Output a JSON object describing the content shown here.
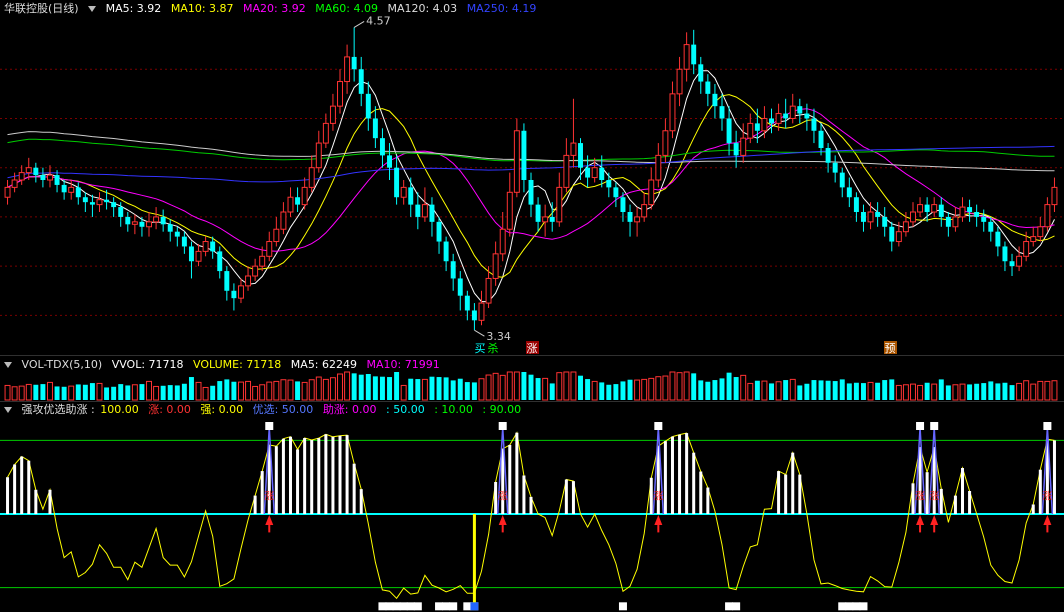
{
  "price_header": {
    "title": "华联控股(日线)",
    "ma5_label": "MA5: 3.92",
    "ma10_label": "MA10: 3.87",
    "ma20_label": "MA20: 3.92",
    "ma60_label": "MA60: 4.09",
    "ma120_label": "MA120: 4.03",
    "ma250_label": "MA250: 4.19"
  },
  "vol_header": {
    "title": "VOL-TDX(5,10)",
    "vvol_label": "VVOL: 71718",
    "volume_label": "VOLUME: 71718",
    "ma5_label": "MA5: 62249",
    "ma10_label": "MA10: 71991"
  },
  "ind_header": {
    "title": "强攻优选助涨 :",
    "v1": "100.00",
    "zhang_label": "涨: 0.00",
    "qiang_label": "强: 0.00",
    "youxuan_label": "优选: 50.00",
    "zhuzhang_label": "助涨: 0.00",
    "v2": ": 50.00",
    "v3": ": 10.00",
    "v4": ": 90.00"
  },
  "annotations": {
    "high": "4.57",
    "low": "3.34",
    "buy": "买",
    "kill": "杀",
    "rise": "涨",
    "pre": "预"
  },
  "colors": {
    "ma5": "#ffffff",
    "ma10": "#ffff00",
    "ma20": "#ff00ff",
    "ma60": "#00cc00",
    "ma120": "#cccccc",
    "ma250": "#3333ff",
    "up": "#ff3333",
    "down": "#00ffff"
  },
  "chart_data": [
    {
      "type": "candlestick",
      "title": "华联控股(日线)",
      "ylim": [
        3.3,
        4.6
      ],
      "high_marker": 4.57,
      "low_marker": 3.34,
      "ma_latest": {
        "MA5": 3.92,
        "MA10": 3.87,
        "MA20": 3.92,
        "MA60": 4.09,
        "MA120": 4.03,
        "MA250": 4.19
      },
      "candles": [
        [
          3.88,
          3.92,
          3.85,
          3.95
        ],
        [
          3.92,
          3.95,
          3.9,
          3.98
        ],
        [
          3.95,
          3.98,
          3.93,
          4.01
        ],
        [
          3.98,
          4.0,
          3.95,
          4.04
        ],
        [
          4.0,
          3.97,
          3.94,
          4.02
        ],
        [
          3.97,
          3.95,
          3.92,
          4.0
        ],
        [
          3.95,
          3.97,
          3.92,
          4.01
        ],
        [
          3.97,
          3.93,
          3.9,
          3.99
        ],
        [
          3.93,
          3.9,
          3.87,
          3.95
        ],
        [
          3.9,
          3.92,
          3.87,
          3.95
        ],
        [
          3.92,
          3.88,
          3.85,
          3.94
        ],
        [
          3.88,
          3.86,
          3.82,
          3.9
        ],
        [
          3.86,
          3.85,
          3.8,
          3.89
        ],
        [
          3.85,
          3.87,
          3.82,
          3.9
        ],
        [
          3.87,
          3.86,
          3.83,
          3.91
        ],
        [
          3.86,
          3.84,
          3.8,
          3.88
        ],
        [
          3.84,
          3.8,
          3.76,
          3.86
        ],
        [
          3.8,
          3.77,
          3.74,
          3.82
        ],
        [
          3.77,
          3.78,
          3.73,
          3.81
        ],
        [
          3.78,
          3.76,
          3.72,
          3.8
        ],
        [
          3.76,
          3.78,
          3.72,
          3.82
        ],
        [
          3.78,
          3.8,
          3.75,
          3.84
        ],
        [
          3.8,
          3.77,
          3.74,
          3.83
        ],
        [
          3.77,
          3.74,
          3.7,
          3.79
        ],
        [
          3.74,
          3.72,
          3.68,
          3.76
        ],
        [
          3.72,
          3.68,
          3.65,
          3.74
        ],
        [
          3.68,
          3.62,
          3.55,
          3.7
        ],
        [
          3.62,
          3.66,
          3.6,
          3.69
        ],
        [
          3.66,
          3.7,
          3.64,
          3.72
        ],
        [
          3.7,
          3.66,
          3.63,
          3.72
        ],
        [
          3.66,
          3.58,
          3.55,
          3.68
        ],
        [
          3.58,
          3.5,
          3.46,
          3.6
        ],
        [
          3.5,
          3.47,
          3.42,
          3.53
        ],
        [
          3.47,
          3.52,
          3.45,
          3.55
        ],
        [
          3.52,
          3.56,
          3.5,
          3.6
        ],
        [
          3.56,
          3.6,
          3.54,
          3.63
        ],
        [
          3.6,
          3.64,
          3.58,
          3.68
        ],
        [
          3.64,
          3.7,
          3.62,
          3.74
        ],
        [
          3.7,
          3.75,
          3.68,
          3.8
        ],
        [
          3.75,
          3.82,
          3.73,
          3.86
        ],
        [
          3.82,
          3.88,
          3.8,
          3.92
        ],
        [
          3.88,
          3.85,
          3.82,
          3.92
        ],
        [
          3.85,
          3.92,
          3.83,
          3.96
        ],
        [
          3.92,
          4.0,
          3.9,
          4.05
        ],
        [
          4.0,
          4.1,
          3.98,
          4.15
        ],
        [
          4.1,
          4.18,
          4.08,
          4.22
        ],
        [
          4.18,
          4.25,
          4.15,
          4.3
        ],
        [
          4.25,
          4.35,
          4.22,
          4.4
        ],
        [
          4.35,
          4.45,
          4.3,
          4.5
        ],
        [
          4.45,
          4.4,
          4.35,
          4.57
        ],
        [
          4.4,
          4.3,
          4.25,
          4.45
        ],
        [
          4.3,
          4.2,
          4.15,
          4.35
        ],
        [
          4.2,
          4.12,
          4.08,
          4.25
        ],
        [
          4.12,
          4.05,
          4.0,
          4.16
        ],
        [
          4.05,
          4.0,
          3.95,
          4.1
        ],
        [
          4.0,
          3.88,
          3.85,
          4.05
        ],
        [
          3.88,
          3.92,
          3.85,
          3.95
        ],
        [
          3.92,
          3.85,
          3.8,
          3.96
        ],
        [
          3.85,
          3.8,
          3.75,
          3.9
        ],
        [
          3.8,
          3.85,
          3.78,
          3.92
        ],
        [
          3.85,
          3.78,
          3.72,
          3.88
        ],
        [
          3.78,
          3.7,
          3.65,
          3.8
        ],
        [
          3.7,
          3.62,
          3.58,
          3.72
        ],
        [
          3.62,
          3.55,
          3.5,
          3.65
        ],
        [
          3.55,
          3.48,
          3.42,
          3.58
        ],
        [
          3.48,
          3.42,
          3.38,
          3.5
        ],
        [
          3.42,
          3.38,
          3.34,
          3.45
        ],
        [
          3.38,
          3.45,
          3.36,
          3.5
        ],
        [
          3.45,
          3.55,
          3.43,
          3.6
        ],
        [
          3.55,
          3.65,
          3.52,
          3.7
        ],
        [
          3.65,
          3.75,
          3.62,
          3.82
        ],
        [
          3.75,
          3.9,
          3.72,
          3.98
        ],
        [
          3.9,
          4.15,
          3.88,
          4.2
        ],
        [
          4.15,
          3.95,
          3.9,
          4.18
        ],
        [
          3.95,
          3.85,
          3.8,
          3.98
        ],
        [
          3.85,
          3.78,
          3.74,
          3.88
        ],
        [
          3.78,
          3.8,
          3.72,
          3.85
        ],
        [
          3.8,
          3.78,
          3.74,
          3.86
        ],
        [
          3.78,
          3.92,
          3.76,
          3.98
        ],
        [
          3.92,
          4.05,
          3.9,
          4.12
        ],
        [
          4.05,
          4.1,
          4.0,
          4.28
        ],
        [
          4.1,
          4.0,
          3.95,
          4.12
        ],
        [
          4.0,
          3.96,
          3.92,
          4.05
        ],
        [
          3.96,
          4.0,
          3.94,
          4.04
        ],
        [
          4.0,
          3.95,
          3.92,
          4.05
        ],
        [
          3.95,
          3.92,
          3.88,
          3.98
        ],
        [
          3.92,
          3.88,
          3.84,
          3.94
        ],
        [
          3.88,
          3.82,
          3.78,
          3.9
        ],
        [
          3.82,
          3.78,
          3.72,
          3.85
        ],
        [
          3.78,
          3.8,
          3.72,
          3.84
        ],
        [
          3.8,
          3.85,
          3.78,
          3.9
        ],
        [
          3.85,
          3.95,
          3.83,
          4.0
        ],
        [
          3.95,
          4.05,
          3.92,
          4.1
        ],
        [
          4.05,
          4.15,
          4.02,
          4.2
        ],
        [
          4.15,
          4.3,
          4.12,
          4.35
        ],
        [
          4.3,
          4.4,
          4.25,
          4.45
        ],
        [
          4.4,
          4.5,
          4.35,
          4.55
        ],
        [
          4.5,
          4.42,
          4.38,
          4.56
        ],
        [
          4.42,
          4.35,
          4.3,
          4.45
        ],
        [
          4.35,
          4.3,
          4.25,
          4.38
        ],
        [
          4.3,
          4.25,
          4.2,
          4.34
        ],
        [
          4.25,
          4.2,
          4.15,
          4.3
        ],
        [
          4.2,
          4.1,
          4.05,
          4.25
        ],
        [
          4.1,
          4.05,
          4.0,
          4.15
        ],
        [
          4.05,
          4.12,
          4.02,
          4.18
        ],
        [
          4.12,
          4.18,
          4.1,
          4.22
        ],
        [
          4.18,
          4.15,
          4.1,
          4.24
        ],
        [
          4.15,
          4.2,
          4.12,
          4.25
        ],
        [
          4.2,
          4.18,
          4.14,
          4.24
        ],
        [
          4.18,
          4.22,
          4.15,
          4.26
        ],
        [
          4.22,
          4.2,
          4.16,
          4.28
        ],
        [
          4.2,
          4.25,
          4.18,
          4.3
        ],
        [
          4.25,
          4.22,
          4.18,
          4.28
        ],
        [
          4.22,
          4.2,
          4.15,
          4.26
        ],
        [
          4.2,
          4.15,
          4.1,
          4.24
        ],
        [
          4.15,
          4.08,
          4.05,
          4.18
        ],
        [
          4.08,
          4.02,
          3.98,
          4.1
        ],
        [
          4.02,
          3.98,
          3.94,
          4.05
        ],
        [
          3.98,
          3.92,
          3.88,
          4.0
        ],
        [
          3.92,
          3.88,
          3.84,
          3.96
        ],
        [
          3.88,
          3.82,
          3.78,
          3.9
        ],
        [
          3.82,
          3.78,
          3.74,
          3.85
        ],
        [
          3.78,
          3.82,
          3.75,
          3.86
        ],
        [
          3.82,
          3.8,
          3.76,
          3.86
        ],
        [
          3.8,
          3.76,
          3.72,
          3.84
        ],
        [
          3.76,
          3.7,
          3.66,
          3.78
        ],
        [
          3.7,
          3.74,
          3.68,
          3.78
        ],
        [
          3.74,
          3.78,
          3.72,
          3.82
        ],
        [
          3.78,
          3.82,
          3.76,
          3.86
        ],
        [
          3.82,
          3.85,
          3.8,
          3.88
        ],
        [
          3.85,
          3.82,
          3.78,
          3.88
        ],
        [
          3.82,
          3.85,
          3.8,
          3.88
        ],
        [
          3.85,
          3.8,
          3.76,
          3.88
        ],
        [
          3.8,
          3.76,
          3.72,
          3.82
        ],
        [
          3.76,
          3.8,
          3.74,
          3.84
        ],
        [
          3.8,
          3.84,
          3.78,
          3.88
        ],
        [
          3.84,
          3.82,
          3.78,
          3.87
        ],
        [
          3.82,
          3.8,
          3.76,
          3.85
        ],
        [
          3.8,
          3.78,
          3.74,
          3.83
        ],
        [
          3.78,
          3.74,
          3.7,
          3.8
        ],
        [
          3.74,
          3.68,
          3.64,
          3.76
        ],
        [
          3.68,
          3.62,
          3.58,
          3.7
        ],
        [
          3.62,
          3.6,
          3.56,
          3.65
        ],
        [
          3.6,
          3.64,
          3.58,
          3.68
        ],
        [
          3.64,
          3.7,
          3.62,
          3.74
        ],
        [
          3.7,
          3.72,
          3.68,
          3.76
        ],
        [
          3.72,
          3.76,
          3.7,
          3.8
        ],
        [
          3.76,
          3.85,
          3.74,
          3.88
        ],
        [
          3.85,
          3.92,
          3.82,
          3.96
        ]
      ]
    },
    {
      "type": "bar",
      "title": "VOL-TDX(5,10)",
      "latest": {
        "VVOL": 71718,
        "VOLUME": 71718,
        "MA5": 62249,
        "MA10": 71991
      },
      "ylim": [
        0,
        250000
      ]
    },
    {
      "type": "line",
      "title": "强攻优选助涨",
      "ylim": [
        0,
        100
      ],
      "reference_lines": [
        90,
        50,
        10
      ],
      "latest": {
        "value": 100.0,
        "涨": 0.0,
        "强": 0.0,
        "优选": 50.0,
        "助涨": 0.0
      }
    }
  ]
}
